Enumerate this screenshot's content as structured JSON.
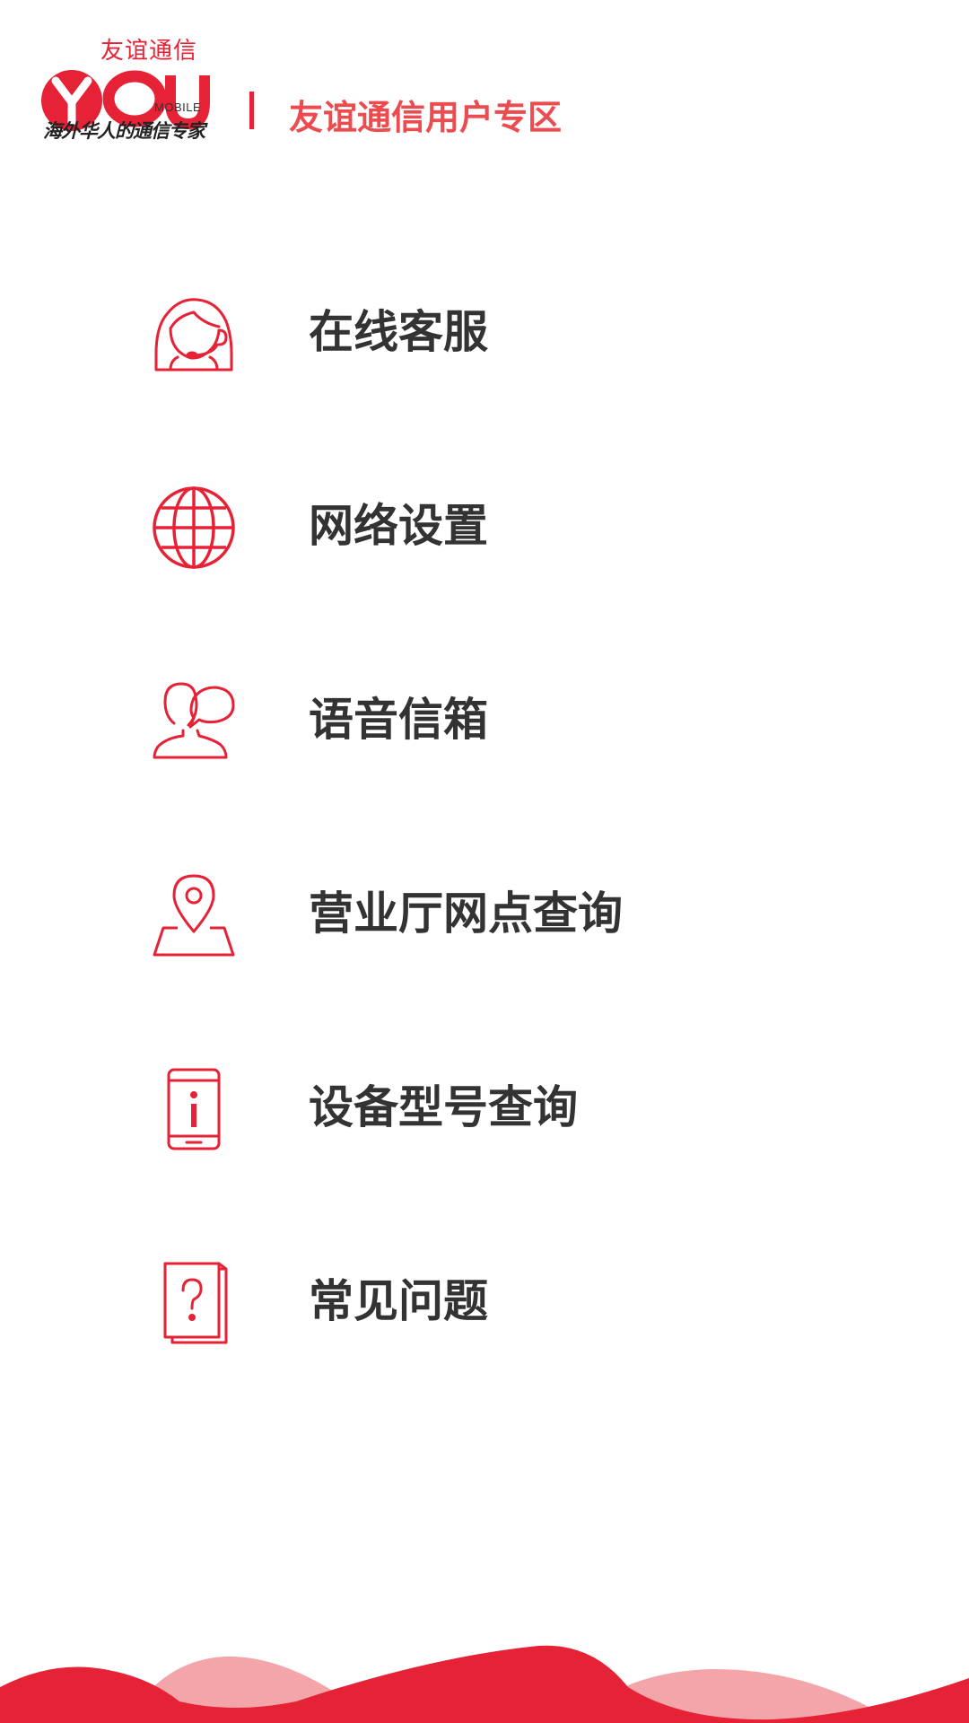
{
  "header": {
    "logo_brand_cn": "友谊通信",
    "logo_letters": "YOU",
    "logo_mobile": "MOBILE",
    "logo_slogan": "海外华人的通信专家",
    "title": "友谊通信用户专区"
  },
  "menu": {
    "items": [
      {
        "label": "在线客服",
        "icon": "customer-service-headset-icon"
      },
      {
        "label": "网络设置",
        "icon": "globe-icon"
      },
      {
        "label": "语音信箱",
        "icon": "person-speech-bubble-icon"
      },
      {
        "label": "营业厅网点查询",
        "icon": "location-pin-map-icon"
      },
      {
        "label": "设备型号查询",
        "icon": "phone-info-icon"
      },
      {
        "label": "常见问题",
        "icon": "question-document-icon"
      }
    ]
  },
  "colors": {
    "brand_red": "#e62236",
    "title_red": "#ec4c4f",
    "wave_light": "#f4a5aa",
    "label_text": "#333333"
  }
}
